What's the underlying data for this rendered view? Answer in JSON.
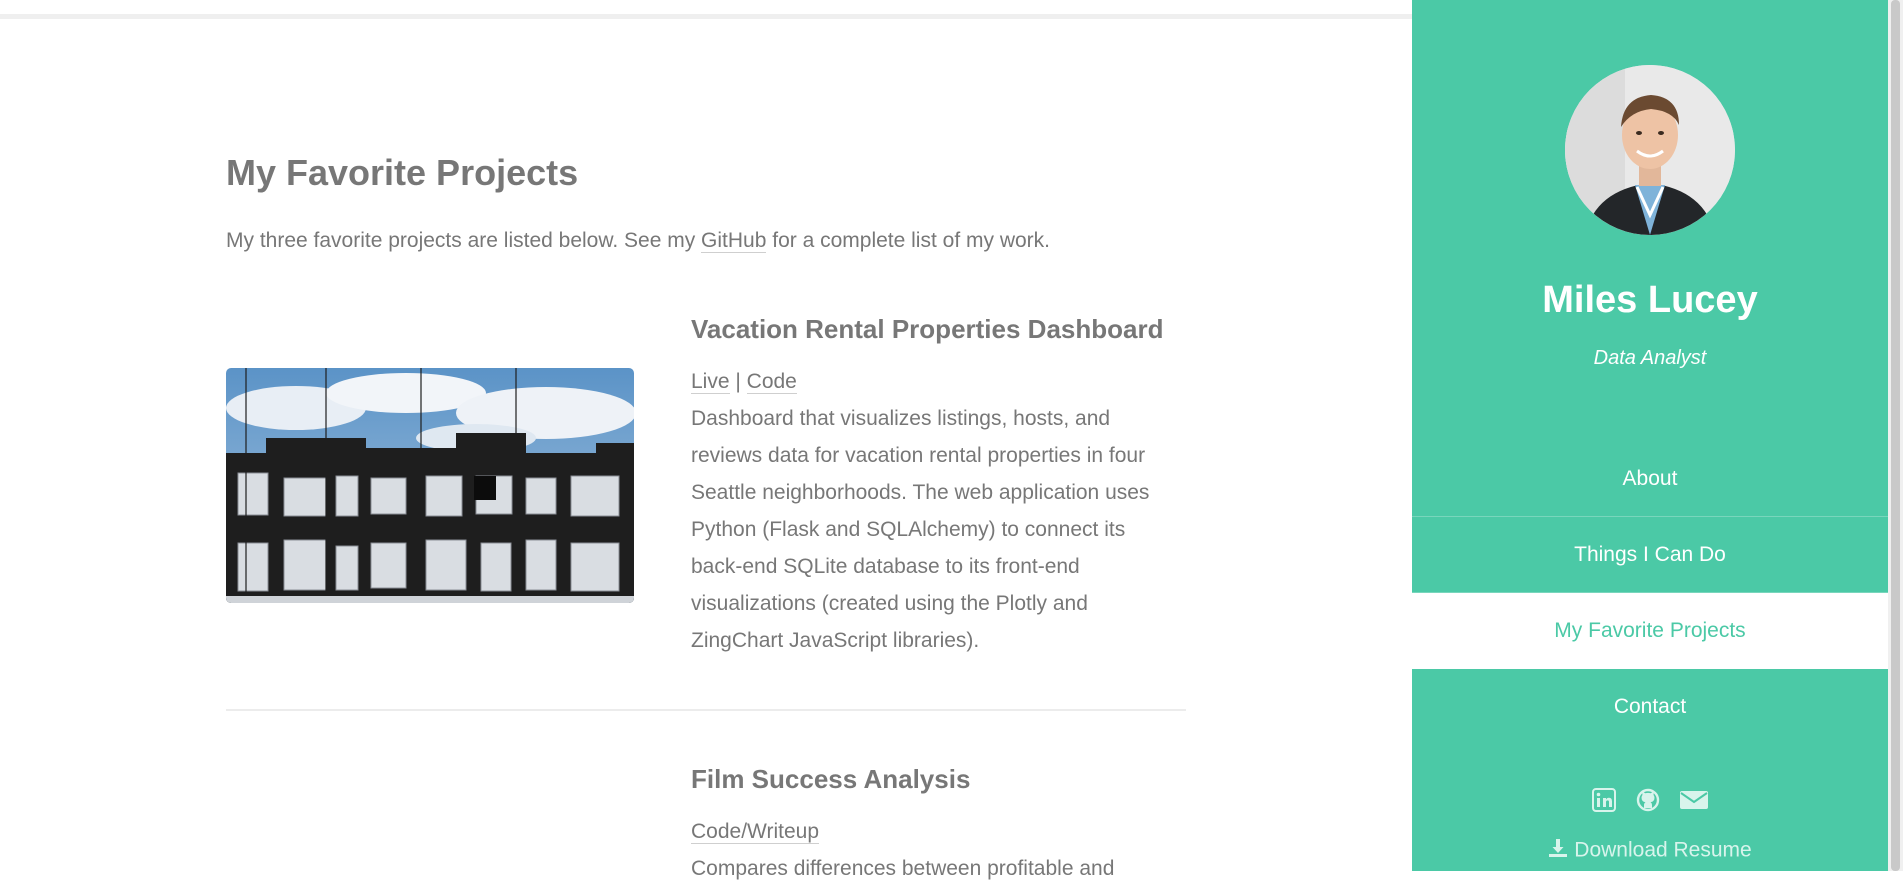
{
  "main": {
    "title": "My Favorite Projects",
    "intro_before": "My three favorite projects are listed below. See my ",
    "intro_link": "GitHub",
    "intro_after": " for a complete list of my work.",
    "projects": [
      {
        "title": "Vacation Rental Properties Dashboard",
        "link_live": "Live",
        "separator": " | ",
        "link_code": "Code",
        "description": "Dashboard that visualizes listings, hosts, and reviews data for vacation rental properties in four Seattle neighborhoods. The web application uses Python (Flask and SQLAlchemy) to connect its back-end SQLite database to its front-end visualizations (created using the Plotly and ZingChart JavaScript libraries)."
      },
      {
        "title": "Film Success Analysis",
        "link_code": "Code/Writeup",
        "description": "Compares differences between profitable and"
      }
    ]
  },
  "sidebar": {
    "name": "Miles Lucey",
    "role": "Data Analyst",
    "nav": [
      {
        "label": "About"
      },
      {
        "label": "Things I Can Do"
      },
      {
        "label": "My Favorite Projects"
      },
      {
        "label": "Contact"
      }
    ],
    "social_icons": [
      "linkedin-icon",
      "github-icon",
      "email-icon"
    ],
    "download_label": "Download Resume"
  },
  "colors": {
    "accent": "#4bc9a6",
    "text": "#777777",
    "background": "#ffffff"
  }
}
